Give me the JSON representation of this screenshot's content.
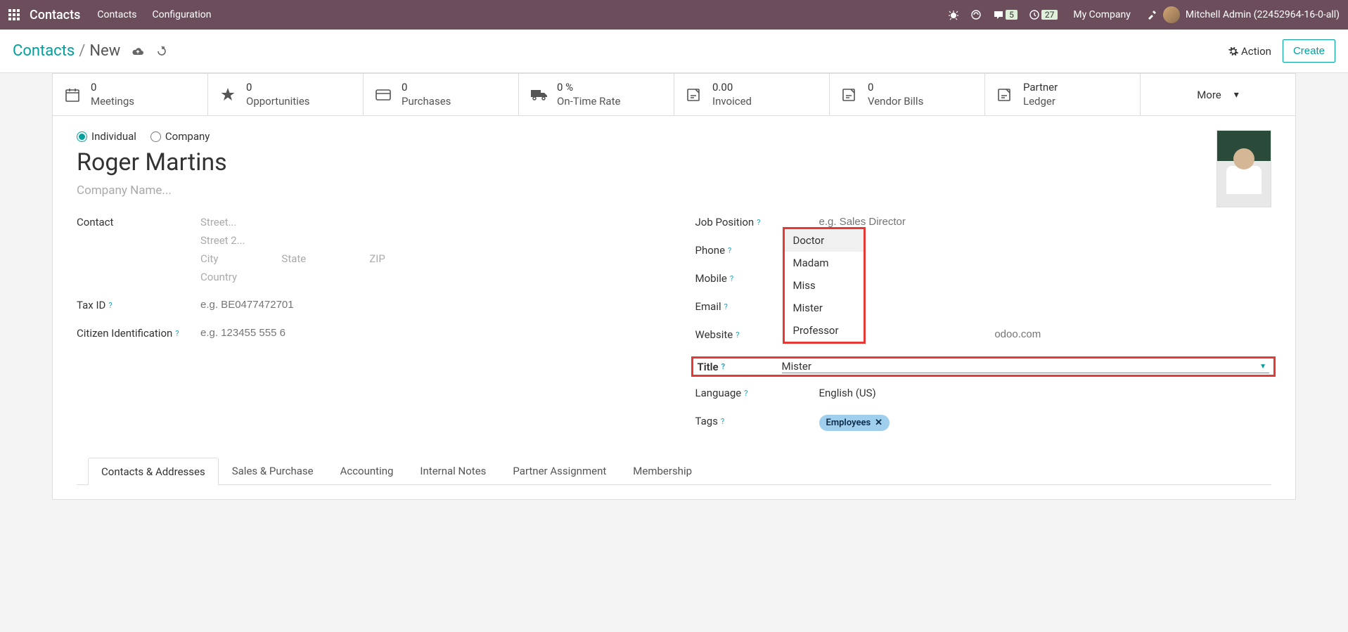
{
  "navbar": {
    "app_title": "Contacts",
    "links": [
      "Contacts",
      "Configuration"
    ],
    "msg_count": "5",
    "clock_count": "27",
    "company": "My Company",
    "username": "Mitchell Admin (22452964-16-0-all)"
  },
  "actionbar": {
    "crumb_main": "Contacts",
    "crumb_cur": "New",
    "action_label": "Action",
    "create_label": "Create"
  },
  "stats": {
    "meetings_val": "0",
    "meetings_label": "Meetings",
    "opps_val": "0",
    "opps_label": "Opportunities",
    "purch_val": "0",
    "purch_label": "Purchases",
    "ontime_val": "0 %",
    "ontime_label": "On-Time Rate",
    "invoiced_val": "0.00",
    "invoiced_label": "Invoiced",
    "vendor_val": "0",
    "vendor_label": "Vendor Bills",
    "ledger_val": "Partner",
    "ledger_label": "Ledger",
    "more": "More"
  },
  "form": {
    "individual": "Individual",
    "company": "Company",
    "name": "Roger Martins",
    "company_ph": "Company Name...",
    "labels": {
      "contact": "Contact",
      "taxid": "Tax ID",
      "citizen": "Citizen Identification",
      "jobpos": "Job Position",
      "phone": "Phone",
      "mobile": "Mobile",
      "email": "Email",
      "website": "Website",
      "title": "Title",
      "language": "Language",
      "tags": "Tags"
    },
    "placeholders": {
      "street": "Street...",
      "street2": "Street 2...",
      "city": "City",
      "state": "State",
      "zip": "ZIP",
      "country": "Country",
      "taxid": "e.g. BE0477472701",
      "citizen": "e.g. 123455 555 6",
      "jobpos": "e.g. Sales Director",
      "website": "odoo.com"
    },
    "title_value": "Mister",
    "language_value": "English (US)",
    "tag_value": "Employees"
  },
  "dropdown": {
    "opt1": "Doctor",
    "opt2": "Madam",
    "opt3": "Miss",
    "opt4": "Mister",
    "opt5": "Professor"
  },
  "tabs": {
    "t1": "Contacts & Addresses",
    "t2": "Sales & Purchase",
    "t3": "Accounting",
    "t4": "Internal Notes",
    "t5": "Partner Assignment",
    "t6": "Membership"
  }
}
